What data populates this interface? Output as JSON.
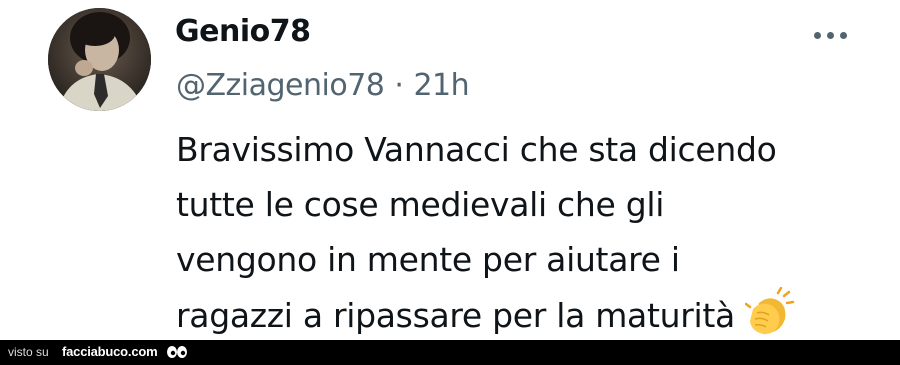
{
  "tweet": {
    "display_name": "Genio78",
    "handle": "@Zziagenio78",
    "separator": "·",
    "time": "21h",
    "more_icon": "ellipsis-icon",
    "body_lines": [
      "Bravissimo Vannacci che sta dicendo",
      "tutte le cose medievali che gli",
      "vengono in mente per aiutare i",
      "ragazzi a ripassare per la maturità"
    ],
    "emoji": "clapping-hands-icon"
  },
  "footer": {
    "visto_su": "visto su",
    "brand": "facciabuco.com",
    "brand_icon": "eyes-icon"
  },
  "colors": {
    "text": "#0f1419",
    "secondary": "#536471",
    "footer_bg": "#000000"
  }
}
